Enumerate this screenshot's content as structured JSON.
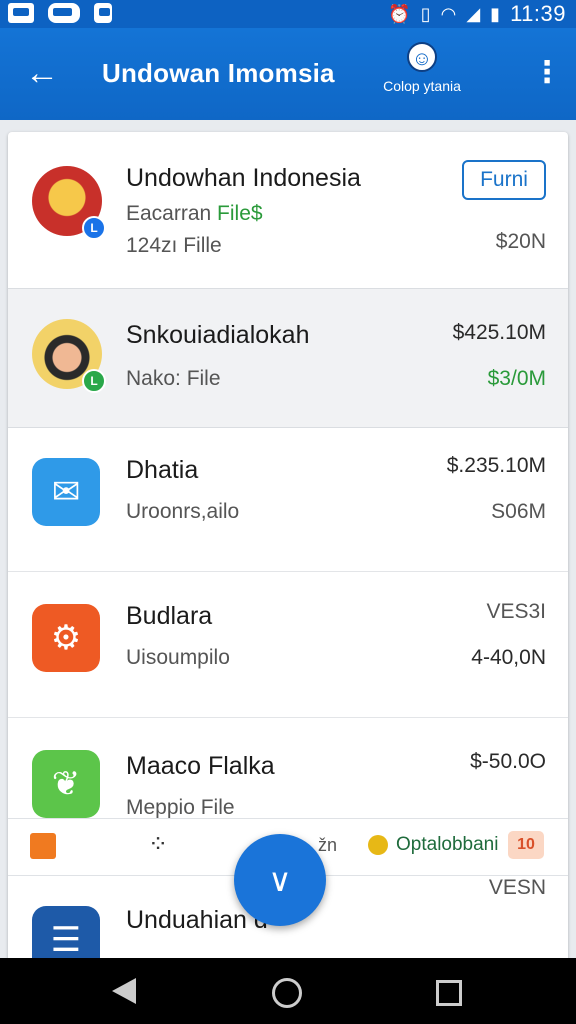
{
  "status_bar": {
    "time": "11:39",
    "icons": [
      "photo-icon",
      "voicemail-icon",
      "app-notification-icon",
      "alarm-icon",
      "vibrate-icon",
      "wifi-icon",
      "signal-icon",
      "battery-icon"
    ]
  },
  "app_bar": {
    "title": "Undowan Imomsia",
    "profile_label": "Colop ytania",
    "icons": [
      "back-arrow-icon",
      "profile-icon",
      "more-vert-icon"
    ]
  },
  "rows": [
    {
      "name": "Undowhan Indonesia",
      "sub_prefix": "Eacarran ",
      "sub_highlight": "File$",
      "sub2": "124zı Fille",
      "button_label": "Furni",
      "value": "$20N",
      "badge": "L",
      "icon": "garuda-avatar-icon"
    },
    {
      "name": "Snkouiadialokah",
      "sub": "Nako: File",
      "value_top": "$425.10M",
      "value_bottom": "$3/0M",
      "badge": "L",
      "icon": "person-avatar-icon"
    },
    {
      "name": "Dhatia",
      "sub": "Uroonrs,ailo",
      "value_top": "$.235.10M",
      "value_bottom": "S06M",
      "icon": "chat-app-icon"
    },
    {
      "name": "Budlara",
      "sub": "Uisoumpilo",
      "value_top": "VES3I",
      "value_bottom": "4-40,0N",
      "icon": "gear-app-icon"
    },
    {
      "name": "Maaco Flalka",
      "sub": "Meppio File",
      "value_top": "$-50.0O",
      "icon": "leaf-app-icon"
    },
    {
      "name": "Unduahian d",
      "value_top": "VESN",
      "icon": "document-app-icon"
    }
  ],
  "strip": {
    "faded_text": "žn",
    "label": "Optalobbani",
    "tag": "10",
    "icons": [
      "orange-square-icon",
      "dots-icon",
      "coin-icon"
    ]
  },
  "fab": {
    "icon": "chevron-down-icon",
    "glyph": "∨"
  },
  "nav": {
    "icons": [
      "nav-back-icon",
      "nav-home-icon",
      "nav-recents-icon"
    ]
  },
  "colors": {
    "primary": "#1474d6",
    "accent_green": "#2a9a3a",
    "orange": "#f07a20"
  }
}
